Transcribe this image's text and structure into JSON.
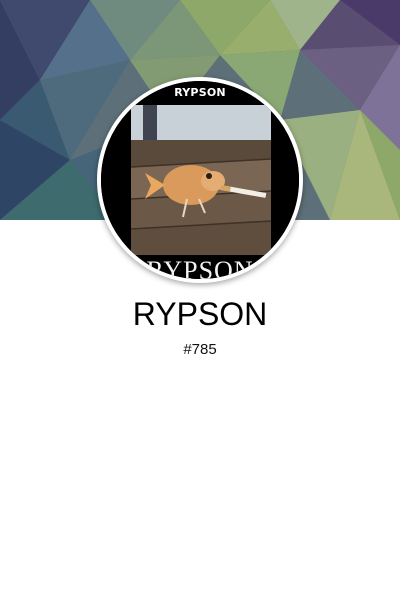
{
  "profile": {
    "name": "RYPSON",
    "number": "#785"
  },
  "avatar": {
    "caption_top": "RYPSON",
    "caption_bottom": "RYPSON",
    "subject": "fish smoking a cigarette on wooden planks"
  },
  "colors": {
    "banner_dark": "#3f4a6e",
    "banner_green": "#8ea86a",
    "banner_purple": "#4a3a6a",
    "page_background": "#ffffff"
  }
}
